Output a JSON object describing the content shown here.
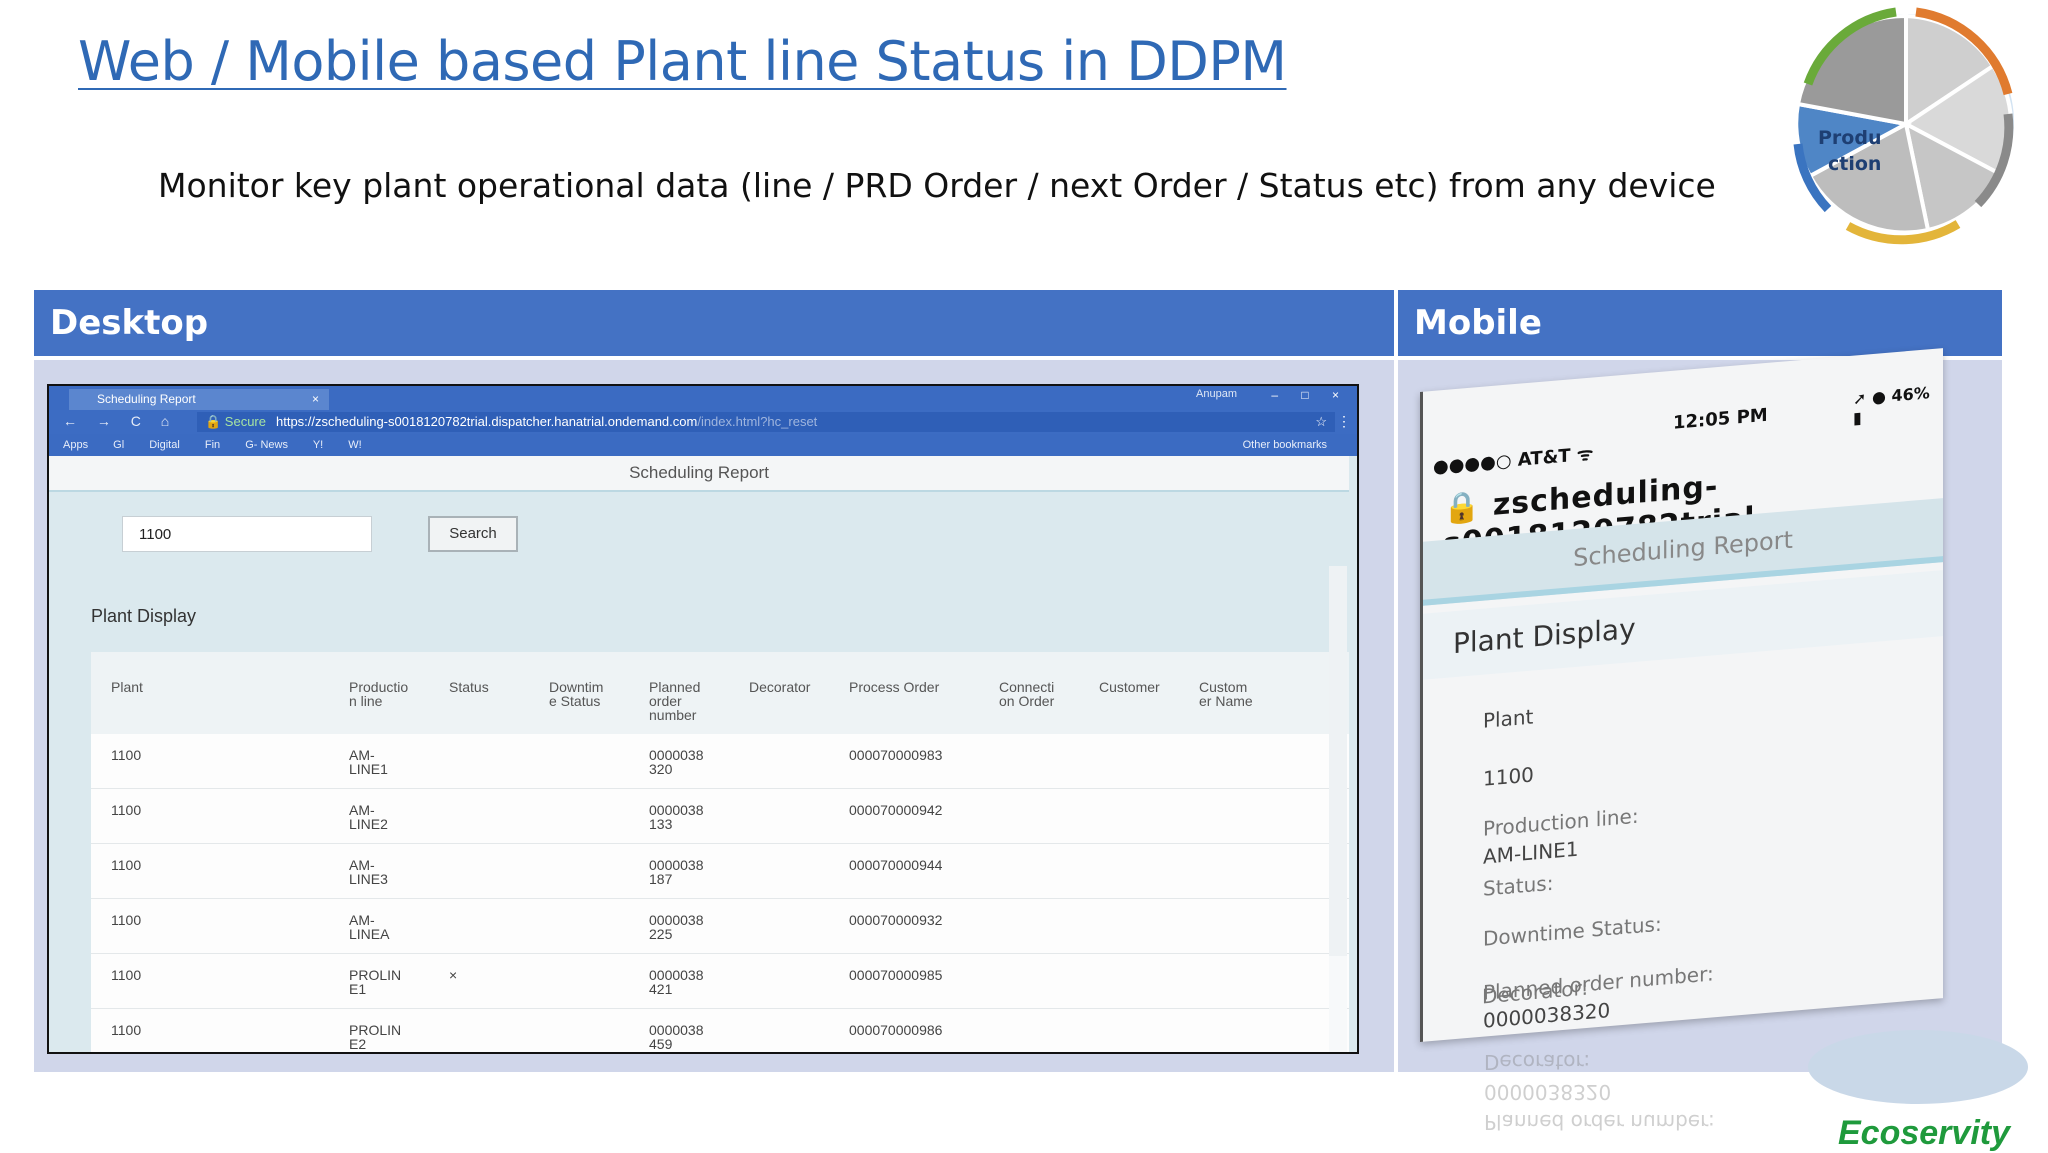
{
  "slide": {
    "title": "Web / Mobile based Plant line Status in DDPM",
    "subtitle": "Monitor key plant operational data (line / PRD Order / next Order / Status etc) from any device",
    "logo_text_1": "Produ",
    "logo_text_2": "ction",
    "brand": "Ecoservity"
  },
  "layout_table": {
    "headers": [
      "Desktop",
      "Mobile"
    ],
    "header_bg": "#4472c4",
    "cell_bg": "#d0d6ea"
  },
  "desktop": {
    "browser": {
      "tab_title": "Scheduling Report",
      "tab_close": "×",
      "user": "Anupam",
      "window_buttons": "– □ ×",
      "nav": "← → C ⌂",
      "secure": "🔒 Secure",
      "url_main": "https://zscheduling-s0018120782trial.dispatcher.hanatrial.ondemand.com",
      "url_faded": "/index.html?hc_reset",
      "star": "☆",
      "menu": "⋮",
      "bookmarks": [
        "Apps",
        "Gl",
        "Digital",
        "Fin",
        "G- News",
        "Y!",
        "W!"
      ],
      "other_bookmarks": "Other bookmarks"
    },
    "app": {
      "report_title": "Scheduling Report",
      "search_value": "1100",
      "search_button": "Search",
      "section_title": "Plant Display",
      "columns": [
        "Plant",
        "Productio\nn line",
        "Status",
        "Downtim\ne Status",
        "Planned\norder\nnumber",
        "Decorator",
        "Process Order",
        "Connecti\non Order",
        "Customer",
        "Custom\ner Name"
      ],
      "rows": [
        {
          "plant": "1100",
          "line": "AM-\nLINE1",
          "status": "",
          "planned": "0000038\n320",
          "process": "000070000983"
        },
        {
          "plant": "1100",
          "line": "AM-\nLINE2",
          "status": "",
          "planned": "0000038\n133",
          "process": "000070000942"
        },
        {
          "plant": "1100",
          "line": "AM-\nLINE3",
          "status": "",
          "planned": "0000038\n187",
          "process": "000070000944"
        },
        {
          "plant": "1100",
          "line": "AM-\nLINEA",
          "status": "",
          "planned": "0000038\n225",
          "process": "000070000932"
        },
        {
          "plant": "1100",
          "line": "PROLIN\nE1",
          "status": "×",
          "planned": "0000038\n421",
          "process": "000070000985"
        },
        {
          "plant": "1100",
          "line": "PROLIN\nE2",
          "status": "",
          "planned": "0000038\n459",
          "process": "000070000986"
        }
      ]
    }
  },
  "mobile": {
    "carrier": "●●●●○ AT&T ᯤ",
    "time": "12:05 PM",
    "battery": "➚ ● 46% ▮",
    "url": "zscheduling-s0018120782trial",
    "report_title": "Scheduling Report",
    "section_title": "Plant Display",
    "plant_label": "Plant",
    "plant_value": "1100",
    "line_label": "Production line:",
    "line_value": "AM-LINE1",
    "status_label": "Status:",
    "downtime_label": "Downtime Status:",
    "planned_label": "Planned order number:",
    "planned_value": "0000038320",
    "decorator_label": "Decorator:"
  }
}
